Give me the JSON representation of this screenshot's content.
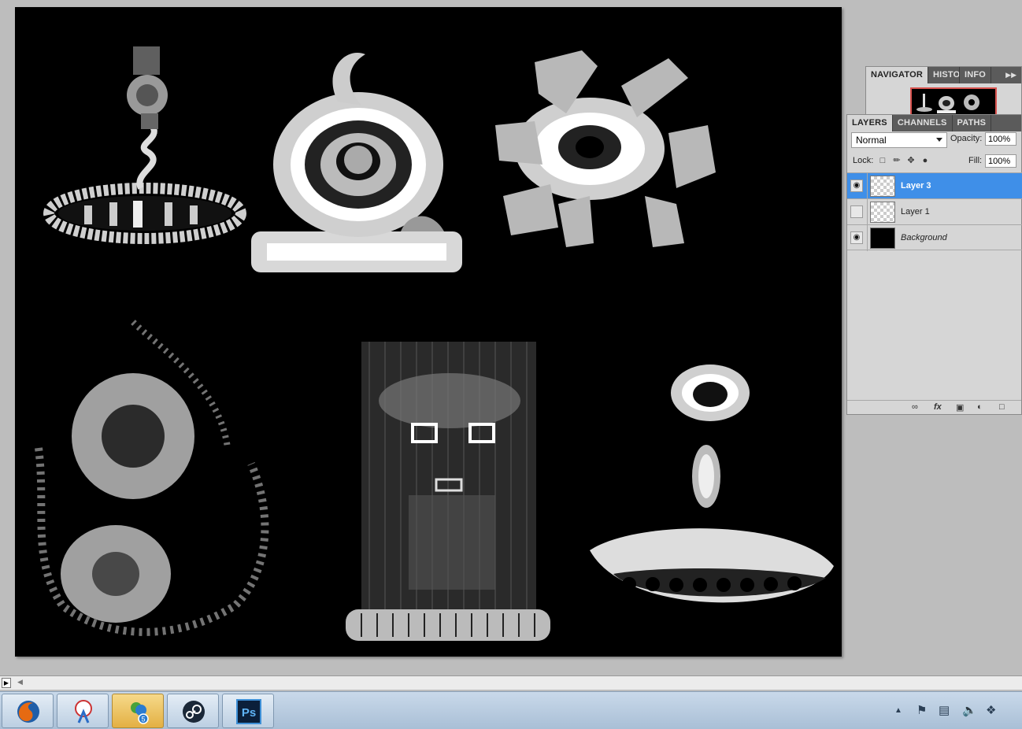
{
  "navigator_panel": {
    "tabs": [
      {
        "label": "NAVIGATOR",
        "active": true
      },
      {
        "label": "HISTO",
        "active": false
      },
      {
        "label": "INFO",
        "active": false
      }
    ],
    "menu_icon": "panel-menu-icon"
  },
  "layers_panel": {
    "tabs": [
      {
        "label": "LAYERS",
        "active": true
      },
      {
        "label": "CHANNELS",
        "active": false
      },
      {
        "label": "PATHS",
        "active": false
      }
    ],
    "blend_mode": "Normal",
    "opacity_label": "Opacity:",
    "opacity_value": "100%",
    "lock_label": "Lock:",
    "fill_label": "Fill:",
    "fill_value": "100%",
    "layers": [
      {
        "name": "Layer 3",
        "visible": true,
        "selected": true
      },
      {
        "name": "Layer 1",
        "visible": false,
        "selected": false
      },
      {
        "name": "Background",
        "visible": true,
        "selected": false
      }
    ],
    "footer_icons": [
      "link-icon",
      "fx-icon",
      "mask-icon",
      "adjustment-icon",
      "group-icon"
    ]
  },
  "taskbar": {
    "apps": [
      {
        "name": "Firefox",
        "icon": "firefox-icon",
        "active": false
      },
      {
        "name": "Snipping Tool",
        "icon": "snipping-tool-icon",
        "active": false
      },
      {
        "name": "Messenger",
        "icon": "messenger-icon",
        "active": true,
        "badge": "5"
      },
      {
        "name": "Steam",
        "icon": "steam-icon",
        "active": false
      },
      {
        "name": "Photoshop",
        "icon": "photoshop-icon",
        "active": false,
        "text": "Ps"
      }
    ],
    "tray_icons": [
      "show-hidden-icons-icon",
      "action-center-icon",
      "network-icon",
      "volume-icon",
      "dropbox-icon"
    ]
  },
  "colors": {
    "selection_blue": "#3f8fe8",
    "panel_bg": "#d6d6d6",
    "tab_bar": "#5b5b5b",
    "canvas_bg": "#000000",
    "nav_view_box": "#d9534f"
  }
}
